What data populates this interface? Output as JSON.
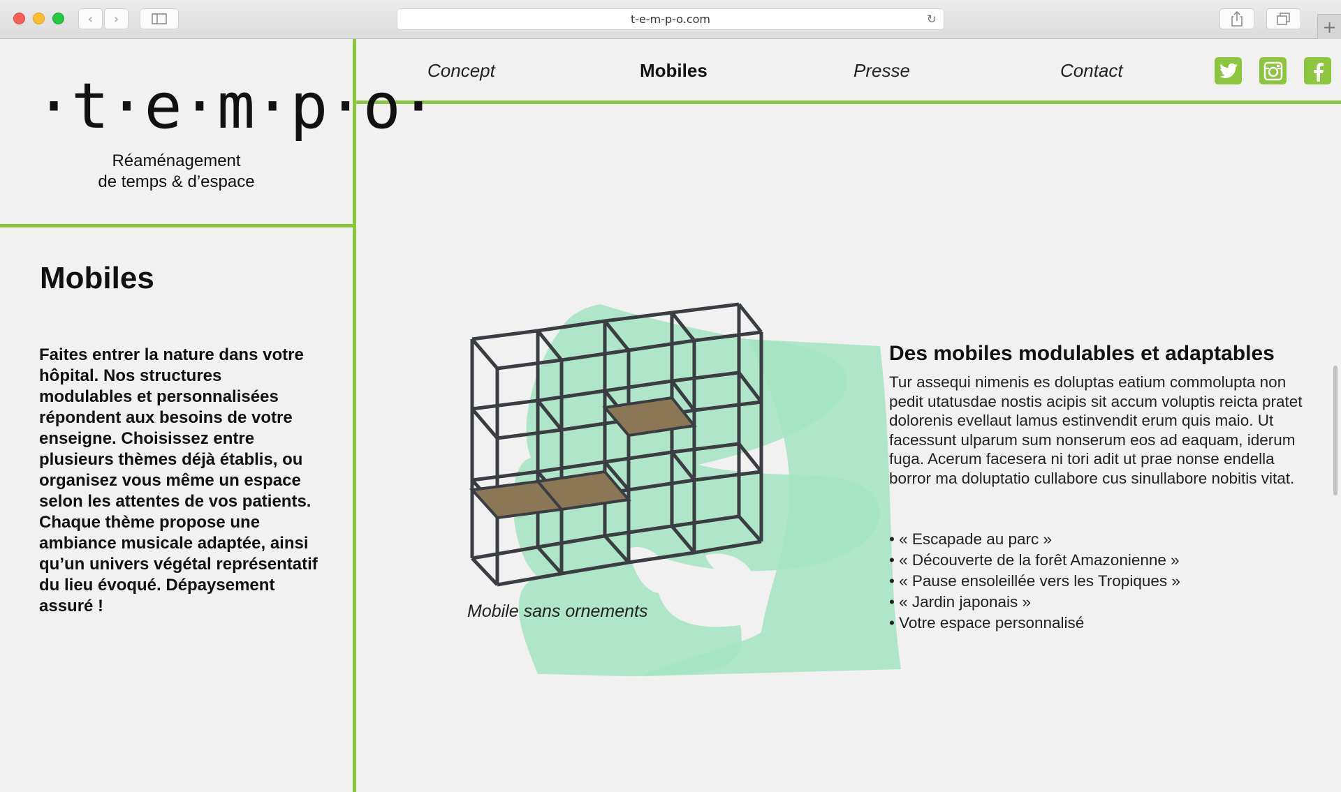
{
  "browser": {
    "url": "t-e-m-p-o.com"
  },
  "brand": {
    "logo_text": "·t·e·m·p·o·",
    "tagline_line1": "Réaménagement",
    "tagline_line2": "de temps & d’espace",
    "accent_color": "#8cc63f"
  },
  "nav": {
    "items": [
      {
        "label": "Concept"
      },
      {
        "label": "Mobiles",
        "active": true
      },
      {
        "label": "Presse"
      },
      {
        "label": "Contact"
      }
    ],
    "social": [
      "twitter-icon",
      "instagram-icon",
      "facebook-icon"
    ]
  },
  "sidebar": {
    "title": "Mobiles",
    "text": "Faites entrer la nature dans votre hôpital. Nos structures modulables et personnalisées répondent aux besoins de votre enseigne. Choisissez entre plusieurs thèmes déjà établis, ou organisez vous même un espace selon les attentes de vos patients. Chaque thème propose une ambiance musicale adaptée, ainsi qu’un univers végétal représentatif du lieu évoqué. Dépaysement assuré !"
  },
  "main": {
    "caption": "Mobile sans ornements",
    "title": "Des mobiles modulables et adaptables",
    "text": "Tur assequi nimenis es doluptas eatium commolupta non pedit utatusdae nostis acipis sit accum voluptis reicta pratet dolorenis evellaut lamus estinvendit erum quis maio. Ut facessunt ulparum sum nonserum eos ad eaquam, iderum fuga. Acerum facesera ni tori adit ut prae nonse endella borror ma doluptatio cullabore cus sinullabore nobitis vitat.",
    "bullets": [
      "« Escapade au parc »",
      "« Découverte de la forêt Amazonienne »",
      "« Pause ensoleillée vers les Tropiques »",
      "« Jardin japonais »",
      "Votre espace personnalisé"
    ]
  }
}
